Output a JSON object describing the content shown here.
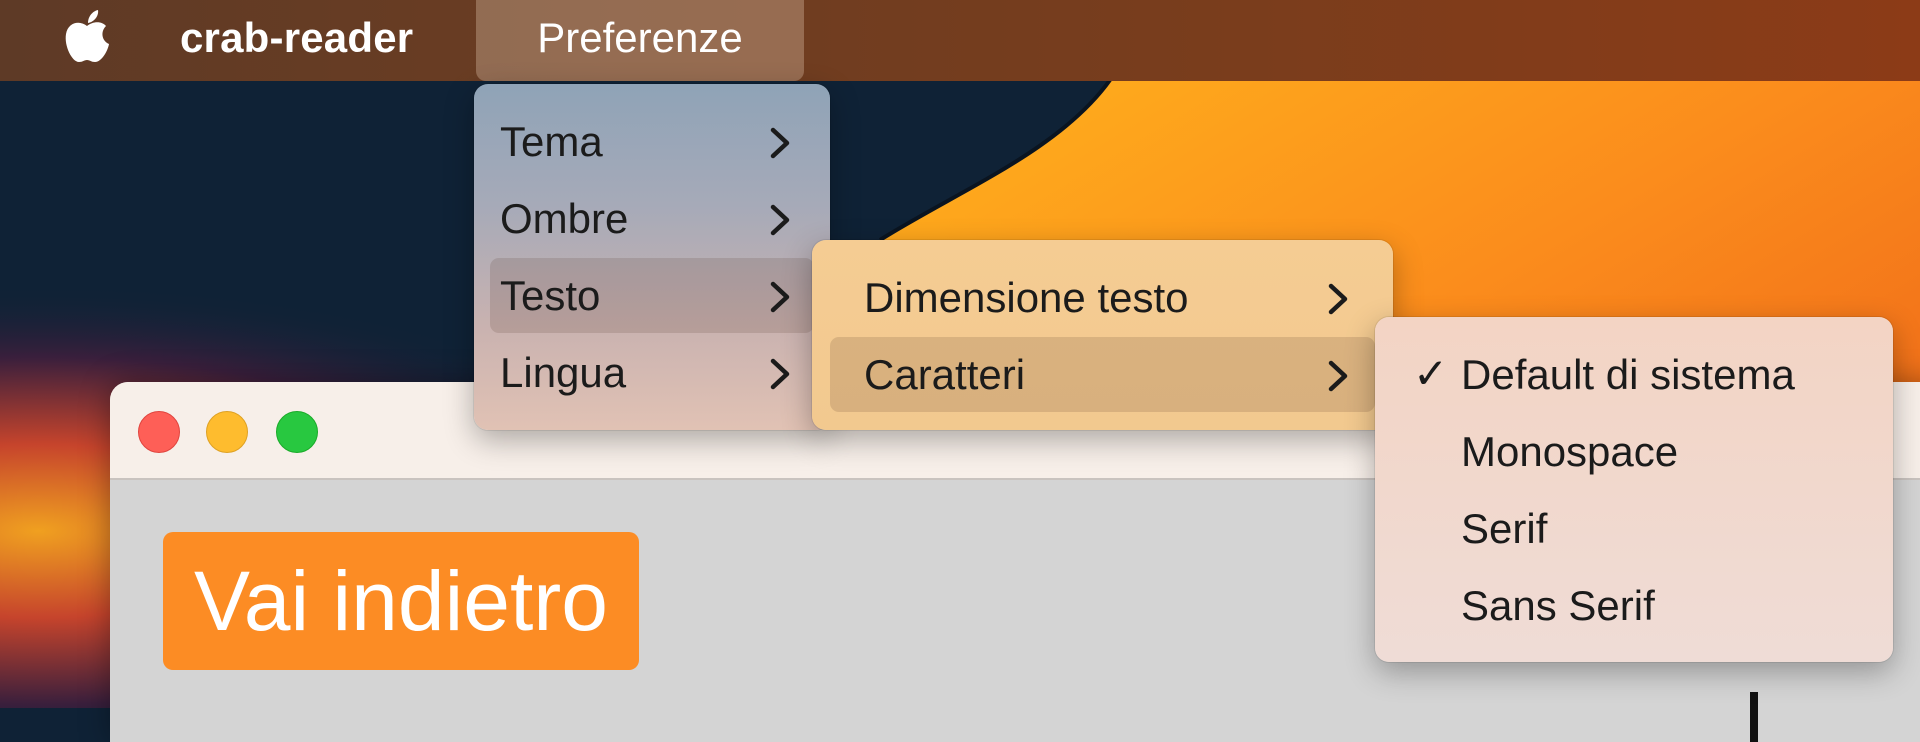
{
  "menubar": {
    "app_name": "crab-reader",
    "menus": [
      {
        "label": "Preferenze",
        "active": true
      }
    ]
  },
  "preferences_menu": {
    "items": [
      {
        "label": "Tema",
        "submenu": true
      },
      {
        "label": "Ombre",
        "submenu": true
      },
      {
        "label": "Testo",
        "submenu": true,
        "selected": true
      },
      {
        "label": "Lingua",
        "submenu": true
      }
    ]
  },
  "text_submenu": {
    "items": [
      {
        "label": "Dimensione testo",
        "submenu": true
      },
      {
        "label": "Caratteri",
        "submenu": true,
        "selected": true
      }
    ]
  },
  "fonts_submenu": {
    "items": [
      {
        "label": "Default di sistema",
        "checked": true,
        "check_mark": "✓"
      },
      {
        "label": "Monospace",
        "checked": false
      },
      {
        "label": "Serif",
        "checked": false
      },
      {
        "label": "Sans Serif",
        "checked": false
      }
    ]
  },
  "window": {
    "back_button_label": "Vai indietro"
  },
  "colors": {
    "back_button": "#fc8c24",
    "close": "#fe5f57",
    "minimize": "#febc2e",
    "zoom": "#28c840"
  }
}
